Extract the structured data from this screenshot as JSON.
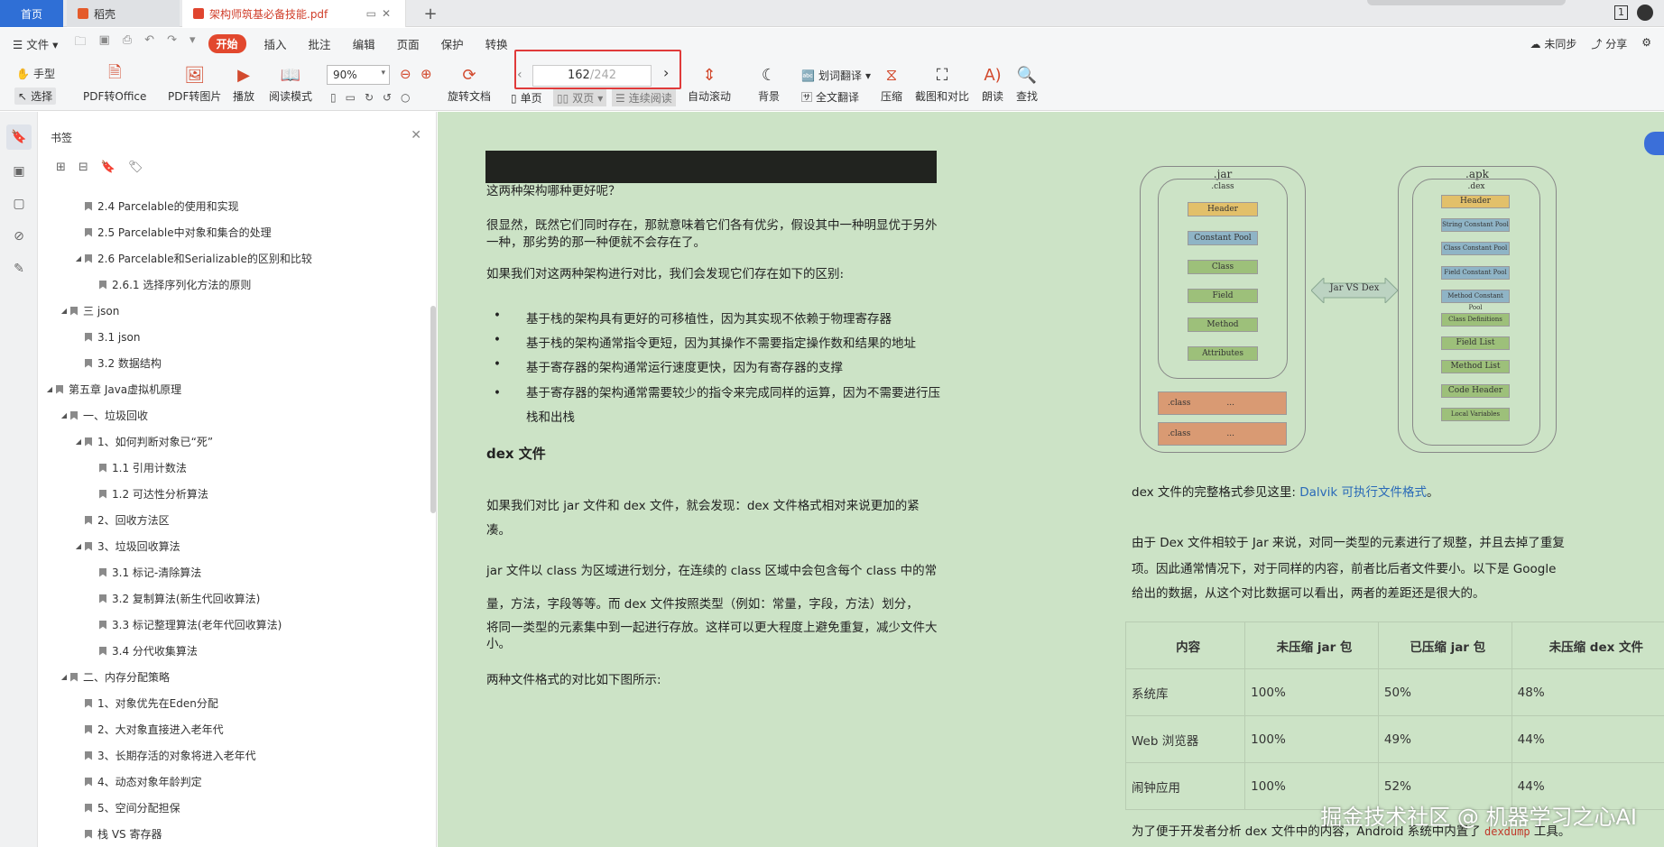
{
  "tabs": [
    {
      "label": "首页"
    },
    {
      "label": "稻壳"
    },
    {
      "label": "架构师筑基必备技能.pdf"
    }
  ],
  "window": {
    "page_indicator": "1"
  },
  "menu": {
    "file": "文件",
    "start": "开始",
    "items": [
      "插入",
      "批注",
      "编辑",
      "页面",
      "保护",
      "转换"
    ],
    "right": [
      "未同步",
      "分享"
    ]
  },
  "toolbar": {
    "hand": "手型",
    "select": "选择",
    "pdf_office": "PDF转Office",
    "pdf_image": "PDF转图片",
    "play": "播放",
    "read_mode": "阅读模式",
    "zoom": "90%",
    "rotate": "旋转文档",
    "page_current": "162",
    "page_total": "/242",
    "single": "单页",
    "double": "双页",
    "continuous": "连续阅读",
    "auto_scroll": "自动滚动",
    "background": "背景",
    "word_translate": "划词翻译",
    "full_translate": "全文翻译",
    "compress": "压缩",
    "screenshot_compare": "截图和对比",
    "read_aloud": "朗读",
    "find": "查找"
  },
  "bookmarks": {
    "title": "书签",
    "items": [
      {
        "label": "2.4 Parcelable的使用和实现",
        "level": 2,
        "expand": ""
      },
      {
        "label": "2.5 Parcelable中对象和集合的处理",
        "level": 2,
        "expand": ""
      },
      {
        "label": "2.6 Parcelable和Serializable的区别和比较",
        "level": 2,
        "expand": "◢"
      },
      {
        "label": "2.6.1 选择序列化方法的原则",
        "level": 3,
        "expand": ""
      },
      {
        "label": "三 json",
        "level": 1,
        "expand": "◢"
      },
      {
        "label": "3.1 json",
        "level": 2,
        "expand": ""
      },
      {
        "label": "3.2 数据结构",
        "level": 2,
        "expand": ""
      },
      {
        "label": "第五章 Java虚拟机原理",
        "level": 0,
        "expand": "◢"
      },
      {
        "label": "一、垃圾回收",
        "level": 1,
        "expand": "◢"
      },
      {
        "label": "1、如何判断对象已“死”",
        "level": 2,
        "expand": "◢"
      },
      {
        "label": "1.1 引用计数法",
        "level": 3,
        "expand": ""
      },
      {
        "label": "1.2 可达性分析算法",
        "level": 3,
        "expand": ""
      },
      {
        "label": "2、回收方法区",
        "level": 2,
        "expand": ""
      },
      {
        "label": "3、垃圾回收算法",
        "level": 2,
        "expand": "◢"
      },
      {
        "label": "3.1 标记-清除算法",
        "level": 3,
        "expand": ""
      },
      {
        "label": "3.2 复制算法(新生代回收算法)",
        "level": 3,
        "expand": ""
      },
      {
        "label": "3.3 标记整理算法(老年代回收算法)",
        "level": 3,
        "expand": ""
      },
      {
        "label": "3.4 分代收集算法",
        "level": 3,
        "expand": ""
      },
      {
        "label": "二、内存分配策略",
        "level": 1,
        "expand": "◢"
      },
      {
        "label": "1、对象优先在Eden分配",
        "level": 2,
        "expand": ""
      },
      {
        "label": "2、大对象直接进入老年代",
        "level": 2,
        "expand": ""
      },
      {
        "label": "3、长期存活的对象将进入老年代",
        "level": 2,
        "expand": ""
      },
      {
        "label": "4、动态对象年龄判定",
        "level": 2,
        "expand": ""
      },
      {
        "label": "5、空间分配担保",
        "level": 2,
        "expand": ""
      },
      {
        "label": "栈 VS 寄存器",
        "level": 2,
        "expand": ""
      }
    ]
  },
  "doc": {
    "left": {
      "q": "这两种架构哪种更好呢？",
      "p1": "很显然，既然它们同时存在，那就意味着它们各有优劣，假设其中一种明显优于另外一种，那劣势的那一种便就不会存在了。",
      "p2": "如果我们对这两种架构进行对比，我们会发现它们存在如下的区别:",
      "bullets": [
        "基于栈的架构具有更好的可移植性，因为其实现不依赖于物理寄存器",
        "基于栈的架构通常指令更短，因为其操作不需要指定操作数和结果的地址",
        "基于寄存器的架构通常运行速度更快，因为有寄存器的支撑",
        "基于寄存器的架构通常需要较少的指令来完成同样的运算，因为不需要进行压栈和出栈"
      ],
      "heading": "dex 文件",
      "p3": "如果我们对比 jar 文件和 dex 文件，就会发现：dex 文件格式相对来说更加的紧凑。",
      "p4a": "jar 文件以 class 为区域进行划分，在连续的 class 区域中会包含每个 class 中的常",
      "p4b": "量，方法，字段等等。而 dex 文件按照类型（例如：常量，字段，方法）划分，",
      "p4c": "将同一类型的元素集中到一起进行存放。这样可以更大程度上避免重复，减少文件大小。",
      "p5": "两种文件格式的对比如下图所示:"
    },
    "diagram": {
      "jar_title": ".jar",
      "jar_class": ".class",
      "jar_items": [
        "Header",
        "Constant Pool",
        "Class",
        "Field",
        "Method",
        "Attributes"
      ],
      "jar_extra": [
        ".class",
        "...",
        ".class",
        "..."
      ],
      "dex_title": ".apk",
      "dex_sub": ".dex",
      "dex_items": [
        "Header",
        "String Constant Pool",
        "Class Constant Pool",
        "Field Constant Pool",
        "Method Constant Pool",
        "Class Definitions",
        "Field List",
        "Method List",
        "Code Header",
        "Local Variables"
      ],
      "arrow": "Jar VS Dex"
    },
    "right": {
      "ref_pre": "dex 文件的完整格式参见这里: ",
      "ref_link": "Dalvik 可执行文件格式",
      "ref_post": "。",
      "p1a": "由于 Dex 文件相较于 Jar 来说，对同一类型的元素进行了规整，并且去掉了重复",
      "p1b": "项。因此通常情况下，对于同样的内容，前者比后者文件要小。以下是 Google",
      "p1c": "给出的数据，从这个对比数据可以看出，两者的差距还是很大的。",
      "table_head": [
        "内容",
        "未压缩 jar 包",
        "已压缩 jar 包",
        "未压缩 dex 文件"
      ],
      "table_rows": [
        [
          "系统库",
          "100%",
          "50%",
          "48%"
        ],
        [
          "Web 浏览器",
          "100%",
          "49%",
          "44%"
        ],
        [
          "闹钟应用",
          "100%",
          "52%",
          "44%"
        ]
      ],
      "last_pre": "为了便于开发者分析 dex 文件中的内容，Android 系统中内置了 ",
      "last_code": "dexdump",
      "last_post": " 工具。"
    },
    "watermark": "掘金技术社区 @ 机器学习之心AI"
  }
}
